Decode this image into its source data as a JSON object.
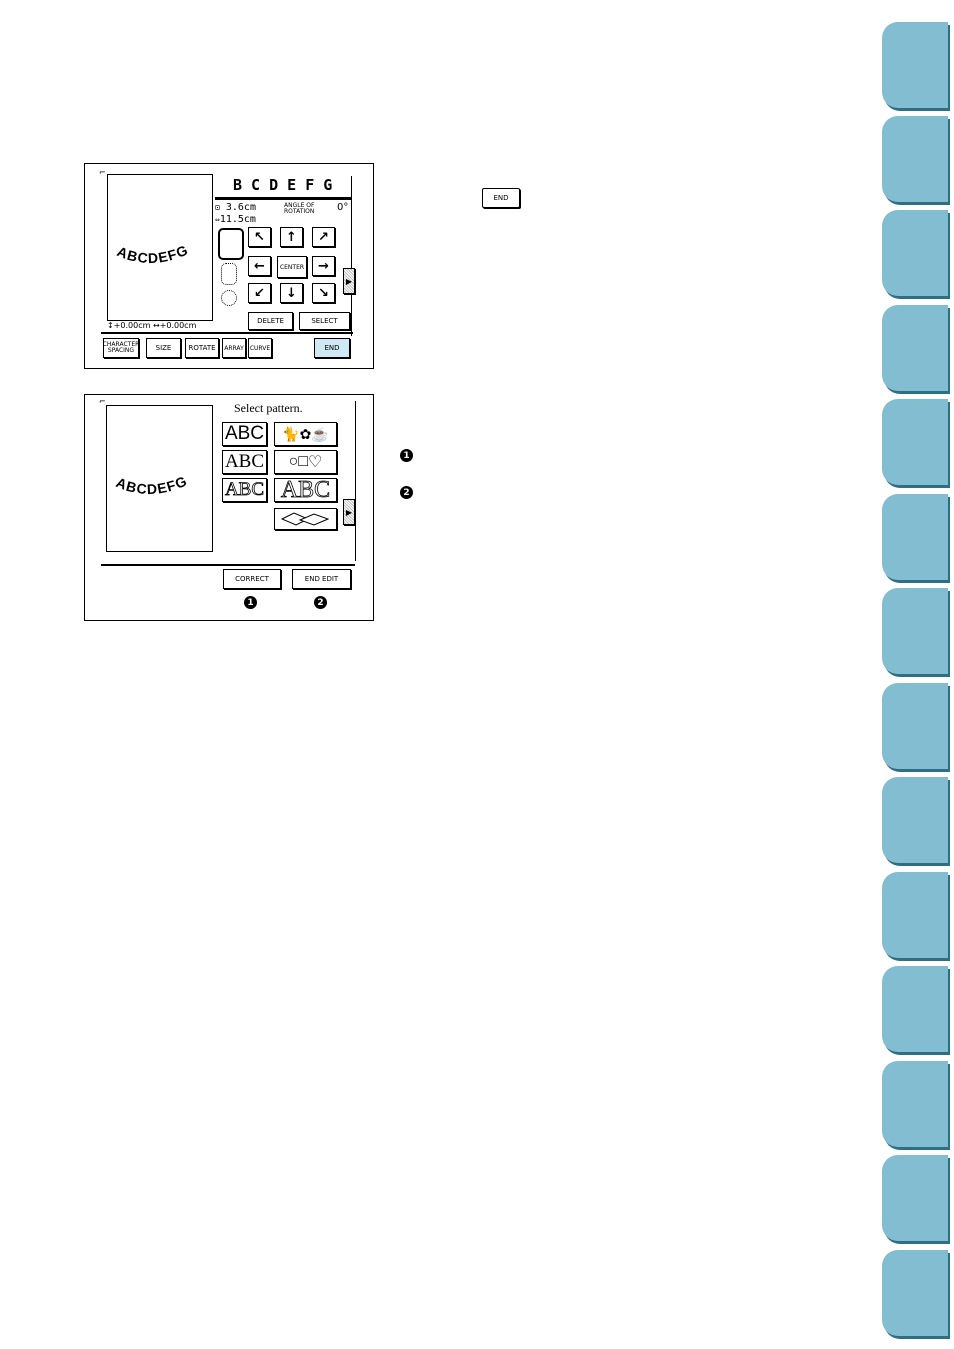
{
  "colors": {
    "tab": "#83bdd1",
    "tab_shadow": "#2f6f86",
    "end_button": "#cfe8f5"
  },
  "tabs_count": 14,
  "inline_end_button": "END",
  "screen1": {
    "title_letters": "B C D E F G",
    "height_value": "3.6cm",
    "width_value": "11.5cm",
    "angle_label_line1": "ANGLE OF",
    "angle_label_line2": "ROTATION",
    "angle_value": "0°",
    "preview_text": "ABCDEFG",
    "center_label": "CENTER",
    "delete_label": "DELETE",
    "select_label": "SELECT",
    "position_readout": "↕+0.00cm ↔+0.00cm",
    "toolbar": {
      "char_spacing_line1": "CHARACTER",
      "char_spacing_line2": "SPACING",
      "size": "SIZE",
      "rotate": "ROTATE",
      "array": "ARRAY",
      "curve": "CURVE",
      "end": "END"
    }
  },
  "screen2": {
    "prompt": "Select pattern.",
    "preview_text": "ABCDEFG",
    "abc": "ABC",
    "correct_label": "CORRECT",
    "end_edit_label": "END EDIT",
    "callout1": "1",
    "callout2": "2"
  },
  "legend": {
    "item1": "1",
    "item2": "2"
  }
}
